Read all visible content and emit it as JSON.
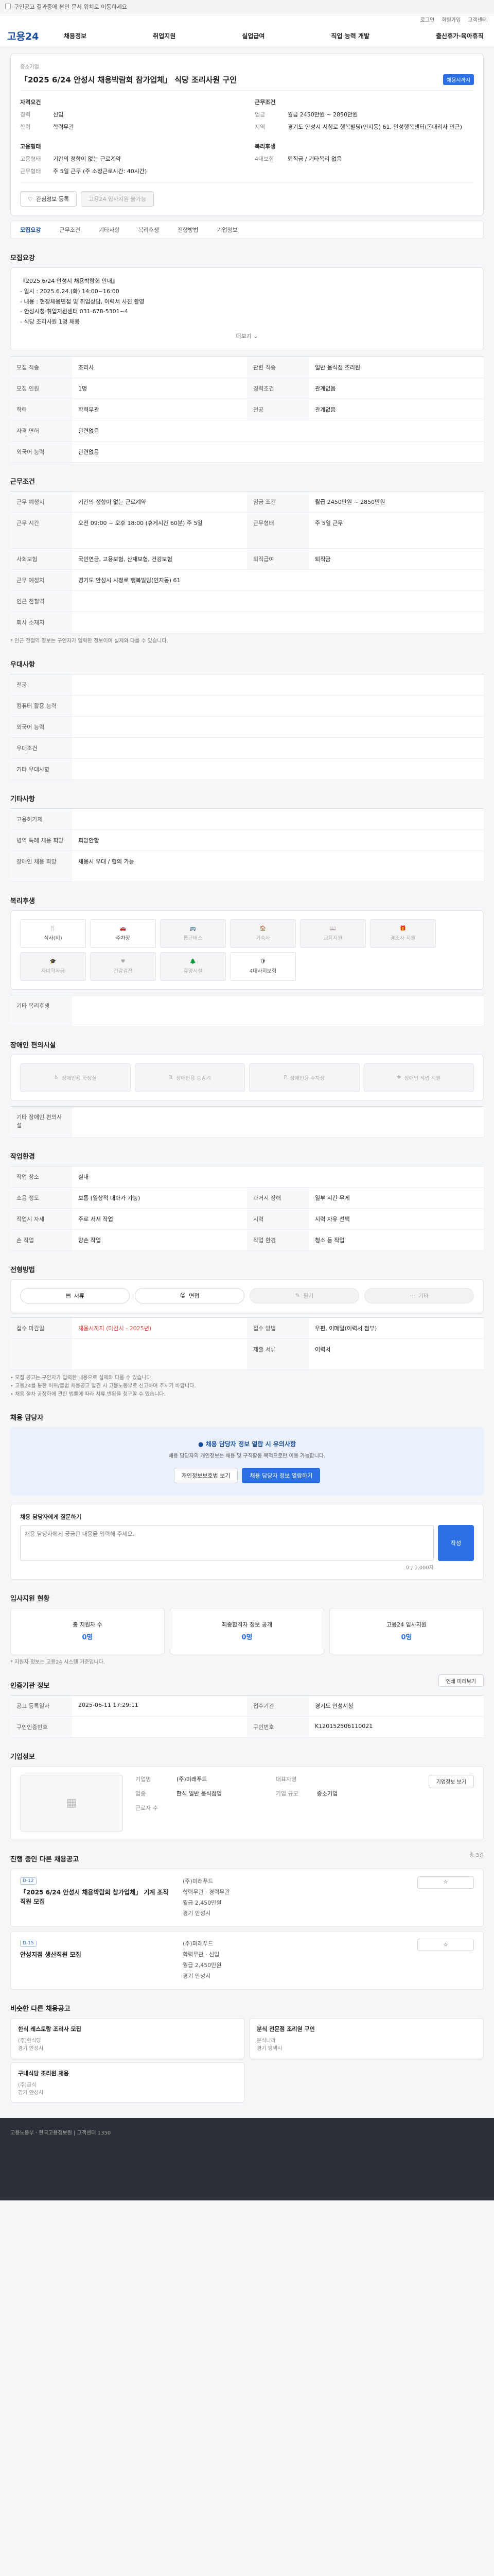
{
  "topbar": {
    "notice": "구인공고 결과중에 본인 문서 위치로 이동하세요"
  },
  "utility": {
    "links": [
      "로그인",
      "회원가입",
      "고객센터"
    ]
  },
  "gnb": {
    "logo": "고용24",
    "menu": [
      "채용정보",
      "취업지원",
      "실업급여",
      "직업 능력 개발",
      "출산휴가·육아휴직"
    ]
  },
  "job": {
    "company_type": "중소기업",
    "title": "「2025 6/24 안성시 채용박람회 참가업체」 식당 조리사원 구인",
    "badge": "채용시까지",
    "corp_head": "자격요건",
    "experience_k": "경력",
    "experience_v": "신입",
    "education_k": "학력",
    "education_v": "학력무관",
    "employ_head": "고용형태",
    "emp_form_k": "고용형태",
    "emp_form_v": "기간의 정함이 없는 근로계약",
    "work_time_k": "근무형태",
    "work_time_v": "주 5일 근무 (주 소정근로시간: 40시간)",
    "condition_head": "근무조건",
    "wage_k": "임금",
    "wage_v": "월급 2450만원 ~ 2850만원",
    "place_k": "지역",
    "place_v": "경기도 안성시 시청로 행복빌딩(인지동) 61, 안성행복센터(돈대리사 인근)",
    "welfare_head": "복리후생",
    "insurance_k": "4대보험",
    "insurance_v": "퇴직금 / 기타복리 없음",
    "btn_interest": "관심정보 등록",
    "btn_apply": "고용24 입사지원 불가능"
  },
  "tabs": [
    "모집요강",
    "근무조건",
    "기타사항",
    "복리후생",
    "전형방법",
    "기업정보"
  ],
  "sec_recruit": {
    "title": "모집요강",
    "intro_lines": [
      "『2025 6/24 안성시 채용박람회 안내』",
      "- 일시 : 2025.6.24.(화) 14:00~16:00",
      "- 내용 : 현장채용면접 및 취업상담, 이력서 사진 촬영",
      "- 안성시청 취업지원센터 031-678-5301~4",
      "- 식당 조리사원 1명 채용"
    ],
    "more_label": "더보기",
    "rows": [
      {
        "k1": "모집 직종",
        "v1": "조리사",
        "k2": "관련 직종",
        "v2": "일반 음식점 조리원"
      },
      {
        "k1": "모집 인원",
        "v1": "1명",
        "k2": "경력조건",
        "v2": "관계없음"
      },
      {
        "k1": "학력",
        "v1": "학력무관",
        "k2": "전공",
        "v2": "관계없음"
      },
      {
        "k1": "자격 면허",
        "v1": "관련없음",
        "k2": "",
        "v2": ""
      }
    ],
    "rows2": [
      {
        "k": "외국어 능력",
        "v": "관련없음"
      }
    ]
  },
  "sec_condition": {
    "title": "근무조건",
    "rows": [
      {
        "k1": "근무 예정지",
        "v1": "기간의 정함이 없는 근로계약",
        "k2": "임금 조건",
        "v2": "월급 2450만원 ~ 2850만원"
      },
      {
        "k1": "근무 시간",
        "v1": "오전 09:00 ~ 오후 18:00 (휴게시간 60분) 주 5일",
        "k2": "근무형태",
        "v2": "주 5일 근무"
      },
      {
        "k1": "사회보험",
        "v1": "국민연금, 고용보험, 산재보험, 건강보험",
        "k2": "퇴직급여",
        "v2": "퇴직금"
      },
      {
        "k1": "근무 예정지",
        "v1": "경기도 안성시 시청로 행복빌딩(인지동) 61",
        "k2": "",
        "v2": ""
      }
    ],
    "rows2": [
      {
        "k": "인근 전철역",
        "v": ""
      },
      {
        "k": "회사 소재지",
        "v": ""
      }
    ],
    "note": "* 인근 전철역 정보는 구인자가 입력한 정보이며 실제와 다를 수 있습니다."
  },
  "sec_pref": {
    "title": "우대사항",
    "rows": [
      {
        "k": "전공",
        "v": ""
      },
      {
        "k": "컴퓨터 활용 능력",
        "v": ""
      },
      {
        "k": "외국어 능력",
        "v": ""
      },
      {
        "k": "우대조건",
        "v": ""
      },
      {
        "k": "기타 우대사항",
        "v": ""
      }
    ]
  },
  "sec_etc": {
    "title": "기타사항",
    "rows": [
      {
        "k": "고용허가제",
        "v": ""
      },
      {
        "k": "병역 특례 채용 희망",
        "v": "희망안함"
      },
      {
        "k": "장애인 채용 희망",
        "v": "채용시 우대 / 협의 가능"
      }
    ]
  },
  "sec_welfare": {
    "title": "복리후생",
    "items": [
      {
        "label": "식사(비)",
        "icon": "meal-icon",
        "on": true
      },
      {
        "label": "주차장",
        "icon": "car-icon",
        "on": true
      },
      {
        "label": "통근버스",
        "icon": "bus-icon",
        "on": false
      },
      {
        "label": "기숙사",
        "icon": "house-icon",
        "on": false
      },
      {
        "label": "교육지원",
        "icon": "book-icon",
        "on": false
      },
      {
        "label": "경조사 지원",
        "icon": "gift-icon",
        "on": false
      },
      {
        "label": "자녀학자금",
        "icon": "grad-icon",
        "on": false
      },
      {
        "label": "건강검진",
        "icon": "heart-icon",
        "on": false
      },
      {
        "label": "휴양시설",
        "icon": "tree-icon",
        "on": false
      },
      {
        "label": "4대사회보험",
        "icon": "shield-icon",
        "on": true
      }
    ],
    "etc_k": "기타 복리후생",
    "etc_v": ""
  },
  "sec_disabled": {
    "title": "장애인 편의시설",
    "items": [
      "장애인용 화장실",
      "장애인용 승강기",
      "장애인용 주차장",
      "장애인 작업 지원"
    ],
    "etc_k": "기타 장애인 편의시설",
    "etc_v": ""
  },
  "sec_work": {
    "title": "작업환경",
    "rows": [
      {
        "k1": "작업 장소",
        "v1": "실내",
        "k2": "",
        "v2": ""
      },
      {
        "k1": "소음 정도",
        "v1": "보통 (일상적 대화가 가능)",
        "k2": "과거시 장해",
        "v2": "일부 시간 무게"
      },
      {
        "k1": "작업시 자세",
        "v1": "주로 서서 작업",
        "k2": "시력",
        "v2": "시력 자유 선택"
      },
      {
        "k1": "손 작업",
        "v1": "양손 작업",
        "k2": "작업 환경",
        "v2": "청소 등 작업"
      }
    ]
  },
  "sec_method": {
    "title": "전형방법",
    "steps": [
      {
        "label": "서류",
        "on": true
      },
      {
        "label": "면접",
        "on": true
      },
      {
        "label": "필기",
        "on": false
      },
      {
        "label": "기타",
        "on": false
      }
    ],
    "rows": [
      {
        "k1": "접수 마감일",
        "v1": "채용시까지 (마감시 - 2025년)",
        "k2": "접수 방법",
        "v2": "우편, 이메일(이력서 첨부)"
      },
      {
        "k1": "",
        "v1": "",
        "k2": "제출 서류",
        "v2": "이력서"
      }
    ],
    "notes": [
      "• 모집 공고는 구인자가 입력한 내용으로 실제와 다를 수 있습니다.",
      "• 고용24를 통한 허위/불법 채용공고 발견 시 고용노동부로 신고하여 주시기 바랍니다.",
      "• 채용 절차 공정화에 관한 법률에 따라 서류 반환을 청구할 수 있습니다."
    ]
  },
  "sec_contact": {
    "title": "채용 담당자",
    "lead": "● 채용 담당자 정보 열람 시 유의사항",
    "text": "채용 담당자의 개인정보는 채용 및 구직활동 목적으로만 이용 가능합니다.",
    "btn1": "개인정보보호법 보기",
    "btn2": "채용 담당자 정보 열람하기"
  },
  "sec_qna": {
    "title": "채용 담당자에게 질문하기",
    "placeholder": "채용 담당자에게 궁금한 내용을 입력해 주세요.",
    "btn": "작성",
    "count": "0 / 1,000자"
  },
  "sec_stats": {
    "title": "입사지원 현황",
    "cards": [
      {
        "label": "총 지원자 수",
        "num": "0명"
      },
      {
        "label": "최종합격자 정보 공개",
        "num": "0명"
      },
      {
        "label": "고용24 입사지원",
        "num": "0명"
      }
    ],
    "note": "* 지원자 정보는 고용24 시스템 기준입니다."
  },
  "sec_info": {
    "title": "인증기관 정보",
    "rows": [
      {
        "k1": "공고 등록일자",
        "v1": "2025-06-11 17:29:11",
        "k2": "접수기관",
        "v2": "경기도 안성시청"
      },
      {
        "k1": "구인인증번호",
        "v1": "",
        "k2": "구인번호",
        "v2": "K120152506110021"
      }
    ],
    "print_btn": "인쇄 미리보기"
  },
  "sec_company": {
    "title": "기업정보",
    "name_k": "기업명",
    "name_v": "(주)미래푸드",
    "rep_k": "대표자명",
    "rep_v": "",
    "industry_k": "업종",
    "industry_v": "한식 일반 음식점업",
    "size_k": "기업 규모",
    "size_v": "중소기업",
    "staff_k": "근로자 수",
    "staff_v": "",
    "btn": "기업정보 보기"
  },
  "sec_jobs": {
    "title": "진행 중인 다른 채용공고",
    "count_text": "총 3건",
    "jobs": [
      {
        "tag": "D-12",
        "title": "「2025 6/24 안성시 채용박람회 참가업체」 기계 조작 직원 모집",
        "company": "(주)미래푸드",
        "info": "학력무관 · 경력무관",
        "wage": "월급 2,450만원",
        "loc": "경기 안성시"
      },
      {
        "tag": "D-15",
        "title": "안성지점 생산직원 모집",
        "company": "(주)미래푸드",
        "info": "학력무관 · 신입",
        "wage": "월급 2,450만원",
        "loc": "경기 안성시"
      }
    ]
  },
  "sec_similar": {
    "title": "비슷한 다른 채용공고",
    "jobs": [
      {
        "title": "한식 레스토랑 조리사 모집",
        "company": "(주)한식당",
        "loc": "경기 안성시"
      },
      {
        "title": "분식 전문점 조리원 구인",
        "company": "분식나라",
        "loc": "경기 평택시"
      },
      {
        "title": "구내식당 조리원 채용",
        "company": "(주)급식",
        "loc": "경기 안성시"
      }
    ]
  },
  "footer": {
    "text": "고용노동부 · 한국고용정보원 | 고객센터 1350"
  }
}
